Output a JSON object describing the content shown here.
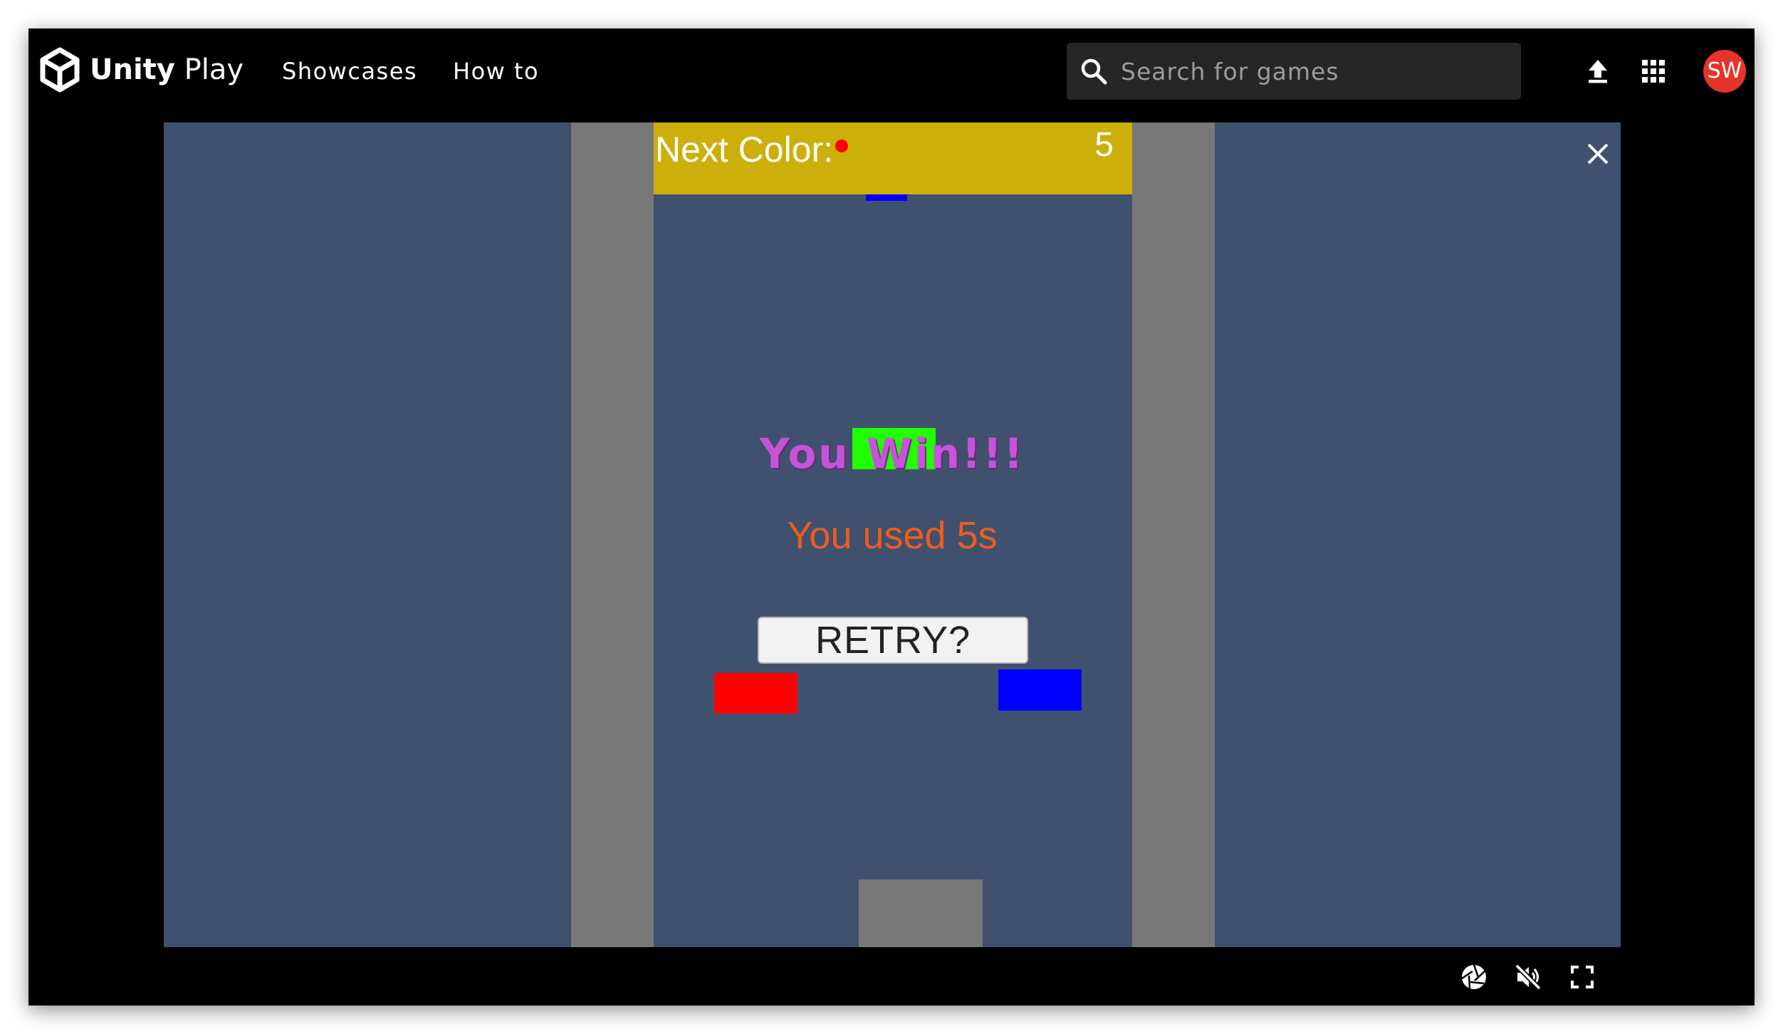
{
  "header": {
    "brand_bold": "Unity",
    "brand_light": "Play",
    "nav": [
      "Showcases",
      "How to"
    ],
    "search_placeholder": "Search for games",
    "avatar_initials": "SW",
    "avatar_color": "#e5342b"
  },
  "game": {
    "next_color_label": "Next Color:",
    "next_color": "#ff0000",
    "score": "5",
    "win_message": "You Win!!!",
    "time_message": "You used 5s",
    "retry_label": "RETRY?",
    "colors": {
      "background": "#405170",
      "walls": "#787878",
      "hud": "#ccaf0a",
      "green_block": "#21ff00",
      "red_block": "#ff0000",
      "blue_block": "#0000ff"
    }
  },
  "icons": {
    "logo": "unity-logo-icon",
    "search": "search-icon",
    "upload": "upload-icon",
    "apps": "apps-grid-icon",
    "close": "close-icon",
    "screenshot": "camera-shutter-icon",
    "mute": "volume-muted-icon",
    "fullscreen": "fullscreen-icon"
  }
}
